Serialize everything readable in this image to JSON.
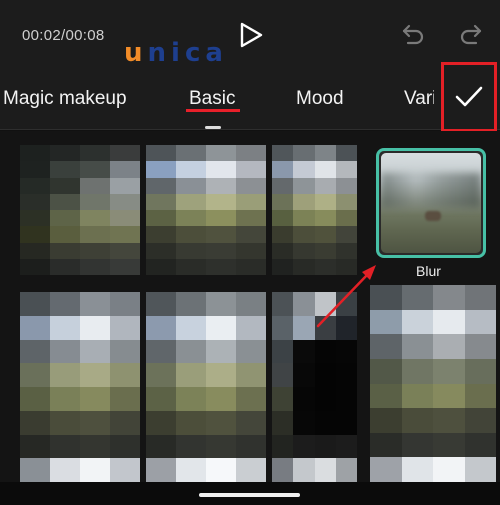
{
  "header": {
    "time": "00:02/00:08",
    "logo_first": "u",
    "logo_rest": "nica"
  },
  "tabs": [
    {
      "label": "Magic makeup"
    },
    {
      "label": "Basic",
      "selected": true
    },
    {
      "label": "Mood"
    },
    {
      "label": "Vari"
    }
  ],
  "filter": {
    "label": "Blur"
  },
  "colors": {
    "accent_teal": "#47c0a6",
    "annotation_red": "#e32026",
    "tab_underline": "#e8202a"
  },
  "thumbnails": [
    [
      "#1d211f",
      "#232625",
      "#2c302e",
      "#3a3c3c",
      "#1e2220",
      "#3a403c",
      "#464c48",
      "#7c8288",
      "#252a26",
      "#30352f",
      "#6e7270",
      "#9aa0a4",
      "#2a2e29",
      "#4c5246",
      "#70766a",
      "#878c85",
      "#2c3025",
      "#5e6448",
      "#7f8460",
      "#8a8c78",
      "#30331f",
      "#5a5e3e",
      "#6c7050",
      "#707452",
      "#262822",
      "#3a3c32",
      "#3e4036",
      "#44463c",
      "#1c1e1c",
      "#2a2c2a",
      "#323432",
      "#383a38"
    ],
    [
      "#4e5458",
      "#6a7074",
      "#8e9498",
      "#7c8084",
      "#8aa0c0",
      "#c4d0e0",
      "#e2e6ec",
      "#b4b8c0",
      "#60666a",
      "#8a9096",
      "#aeb2b6",
      "#8c9094",
      "#70765e",
      "#9ea27c",
      "#b2b48a",
      "#9a9e78",
      "#5c6244",
      "#7c8258",
      "#8c905e",
      "#6e7250",
      "#3c3e30",
      "#4c4e3a",
      "#50523e",
      "#44463a",
      "#2c2e28",
      "#383a32",
      "#3a3c34",
      "#34362e",
      "#222421",
      "#2a2c28",
      "#2e302c",
      "#2a2c28"
    ],
    [
      "#50565a",
      "#686e72",
      "#7e8488",
      "#4c5256",
      "#8a98ac",
      "#c4cad4",
      "#e0e4e8",
      "#b4b8bc",
      "#64696c",
      "#8e9498",
      "#a8acb0",
      "#8c9094",
      "#6c7258",
      "#9ea07a",
      "#aeb086",
      "#8c9070",
      "#586040",
      "#7c8256",
      "#878c5c",
      "#6a6e4c",
      "#3a3c2e",
      "#4c4e3a",
      "#50523c",
      "#42443a",
      "#2a2c26",
      "#363830",
      "#3a3c32",
      "#30322c",
      "#202220",
      "#282a26",
      "#2c2e2a",
      "#282a26"
    ],
    [
      "#4a5054",
      "#646a70",
      "#8a9096",
      "#7a8086",
      "#8a98ac",
      "#c6d0dc",
      "#e8ecf0",
      "#b0b6be",
      "#5e6468",
      "#868c92",
      "#a8aeb4",
      "#868c90",
      "#6a705a",
      "#989c7a",
      "#a8aa86",
      "#8e9270",
      "#5a6044",
      "#7a8058",
      "#868a5e",
      "#6a6e4e",
      "#3a3c30",
      "#4a4c3a",
      "#4e503e",
      "#424438",
      "#262824",
      "#30322e",
      "#343630",
      "#2e302c",
      "#8a9096",
      "#dadde2",
      "#f2f4f6",
      "#c2c6cc"
    ],
    [
      "#50565a",
      "#6c7276",
      "#8c9296",
      "#7a8084",
      "#8c9aae",
      "#c8d2de",
      "#eaeef2",
      "#b2b8c0",
      "#60666a",
      "#8a9094",
      "#acb2b6",
      "#8a9094",
      "#6c725a",
      "#9a9e7a",
      "#acae88",
      "#909472",
      "#5c6246",
      "#7c8258",
      "#888c5e",
      "#6c7050",
      "#3c3e30",
      "#4c4e3a",
      "#50523e",
      "#44463a",
      "#282a26",
      "#323430",
      "#363832",
      "#30322e",
      "#9ca0a6",
      "#e2e6ea",
      "#f6f8fa",
      "#caced2"
    ],
    [
      "#4c5256",
      "#8a9096",
      "#c0c4c8",
      "#3a4044",
      "#5a6268",
      "#9aa6b4",
      "#3a3e42",
      "#20242a",
      "#3c4246",
      "#0a0a0a",
      "#050505",
      "#060606",
      "#404446",
      "#080808",
      "#040404",
      "#050505",
      "#3e4234",
      "#060606",
      "#040404",
      "#050505",
      "#2c2e26",
      "#070707",
      "#050505",
      "#050505",
      "#222420",
      "#1c1c1c",
      "#1a1a1a",
      "#1c1c1c",
      "#787c82",
      "#c4c8cc",
      "#dadde0",
      "#9ea2a6"
    ],
    [
      "#4a5054",
      "#666c70",
      "#84888c",
      "#707478",
      "#8e9caa",
      "#cad2da",
      "#e6eaee",
      "#b6bcc4",
      "#5e6468",
      "#8a9094",
      "#aaaeb2",
      "#868a8e",
      "#525848",
      "#707664",
      "#7c826e",
      "#686e5c",
      "#5a6046",
      "#7a8058",
      "#868a5e",
      "#6a6e4e",
      "#3c3e30",
      "#4a4c3a",
      "#4e503e",
      "#424438",
      "#2a2c28",
      "#343632",
      "#383a34",
      "#30322e",
      "#9ea2a8",
      "#e0e4e8",
      "#f2f4f6",
      "#c4c8cc"
    ]
  ]
}
